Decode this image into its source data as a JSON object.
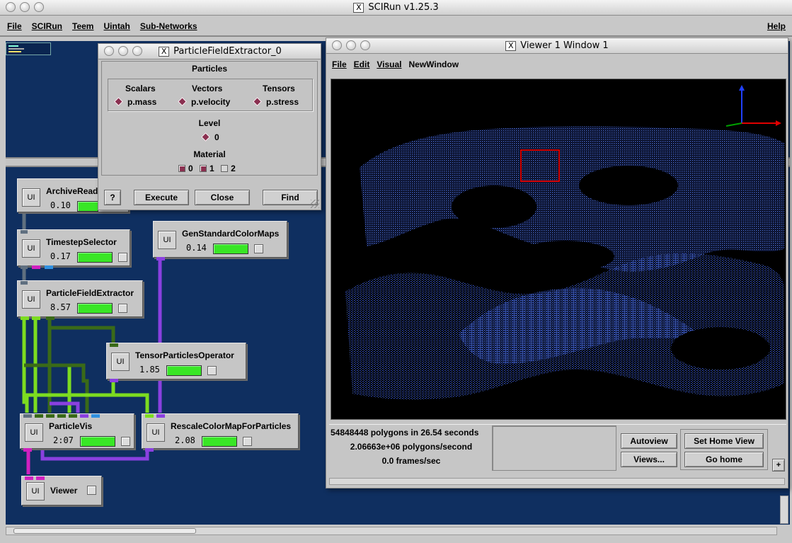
{
  "app": {
    "title": "SCIRun v1.25.3",
    "x_glyph": "X"
  },
  "main_menu": {
    "file": "File",
    "scirun": "SCIRun",
    "teem": "Teem",
    "uintah": "Uintah",
    "subnetworks": "Sub-Networks",
    "help": "Help"
  },
  "modules": [
    {
      "name": "ArchiveRead",
      "time": "0.10",
      "ui": "UI"
    },
    {
      "name": "TimestepSelector",
      "time": "0.17",
      "ui": "UI"
    },
    {
      "name": "GenStandardColorMaps",
      "time": "0.14",
      "ui": "UI"
    },
    {
      "name": "ParticleFieldExtractor",
      "time": "8.57",
      "ui": "UI"
    },
    {
      "name": "TensorParticlesOperator",
      "time": "1.85",
      "ui": "UI"
    },
    {
      "name": "ParticleVis",
      "time": "2:07",
      "ui": "UI"
    },
    {
      "name": "RescaleColorMapForParticles",
      "time": "2.08",
      "ui": "UI"
    },
    {
      "name": "Viewer",
      "time": "",
      "ui": "UI"
    }
  ],
  "extractor": {
    "title": "ParticleFieldExtractor_0",
    "particles_label": "Particles",
    "scalars_label": "Scalars",
    "vectors_label": "Vectors",
    "tensors_label": "Tensors",
    "scalar_value": "p.mass",
    "vector_value": "p.velocity",
    "tensor_value": "p.stress",
    "level_label": "Level",
    "level_value": "0",
    "material_label": "Material",
    "materials": [
      {
        "label": "0",
        "checked": true
      },
      {
        "label": "1",
        "checked": true
      },
      {
        "label": "2",
        "checked": false
      }
    ],
    "help_label": "?",
    "execute_label": "Execute",
    "close_label": "Close",
    "find_label": "Find"
  },
  "viewer": {
    "title": "Viewer 1 Window 1",
    "menu": {
      "file": "File",
      "edit": "Edit",
      "visual": "Visual",
      "newwindow": "NewWindow"
    },
    "stats": {
      "polygons": "54848448 polygons in 26.54 seconds",
      "rate": "2.06663e+06 polygons/second",
      "fps": "0.0 frames/sec"
    },
    "buttons": {
      "autoview": "Autoview",
      "views": "Views...",
      "set_home": "Set Home View",
      "go_home": "Go home",
      "expand": "+"
    }
  },
  "colors": {
    "canvas": "#0f2f60",
    "progress": "#39e626",
    "pipe_green": "#7cdc20",
    "pipe_purple": "#8a40e0",
    "pipe_magenta": "#d020c0",
    "selection_box": "#d00000"
  }
}
